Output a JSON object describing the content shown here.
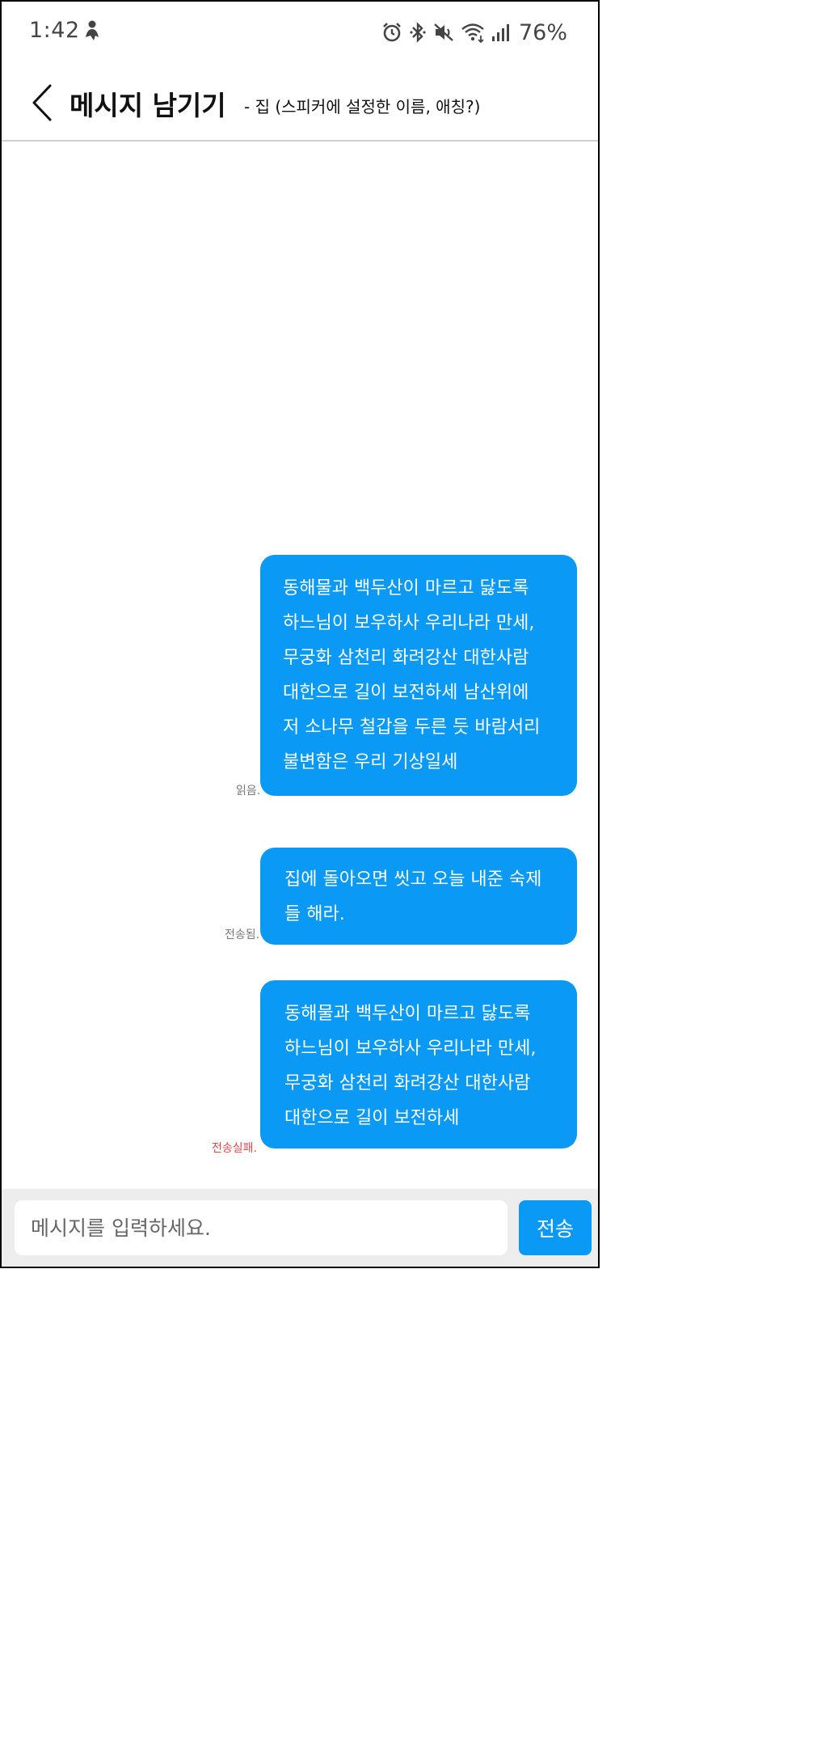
{
  "status_bar": {
    "time": "1:42",
    "battery": "76%",
    "icons": [
      "person-icon",
      "alarm-icon",
      "bluetooth-icon",
      "mute-icon",
      "wifi-icon",
      "signal-icon"
    ]
  },
  "header": {
    "title": "메시지 남기기",
    "subtitle": "- 집 (스피커에 설정한 이름, 애칭?)"
  },
  "messages": [
    {
      "lines": [
        "동해물과 백두산이 마르고 닳도록",
        "하느님이 보우하사 우리나라 만세,",
        "무궁화 삼천리 화려강산 대한사람",
        "대한으로 길이 보전하세 남산위에",
        "저 소나무 철갑을 두른 듯 바람서리",
        "불변함은 우리 기상일세"
      ],
      "status": "읽음."
    },
    {
      "lines": [
        "집에 돌아오면 씻고 오늘 내준 숙제",
        "들 해라."
      ],
      "status": "전송됨."
    },
    {
      "lines": [
        "동해물과 백두산이 마르고 닳도록",
        "하느님이 보우하사 우리나라 만세,",
        "무궁화 삼천리 화려강산 대한사람",
        "대한으로 길이 보전하세"
      ],
      "status": "전송실패."
    }
  ],
  "input": {
    "placeholder": "메시지를 입력하세요.",
    "send_label": "전송"
  },
  "colors": {
    "bubble": "#0a9af5",
    "failed": "#e0474c"
  }
}
